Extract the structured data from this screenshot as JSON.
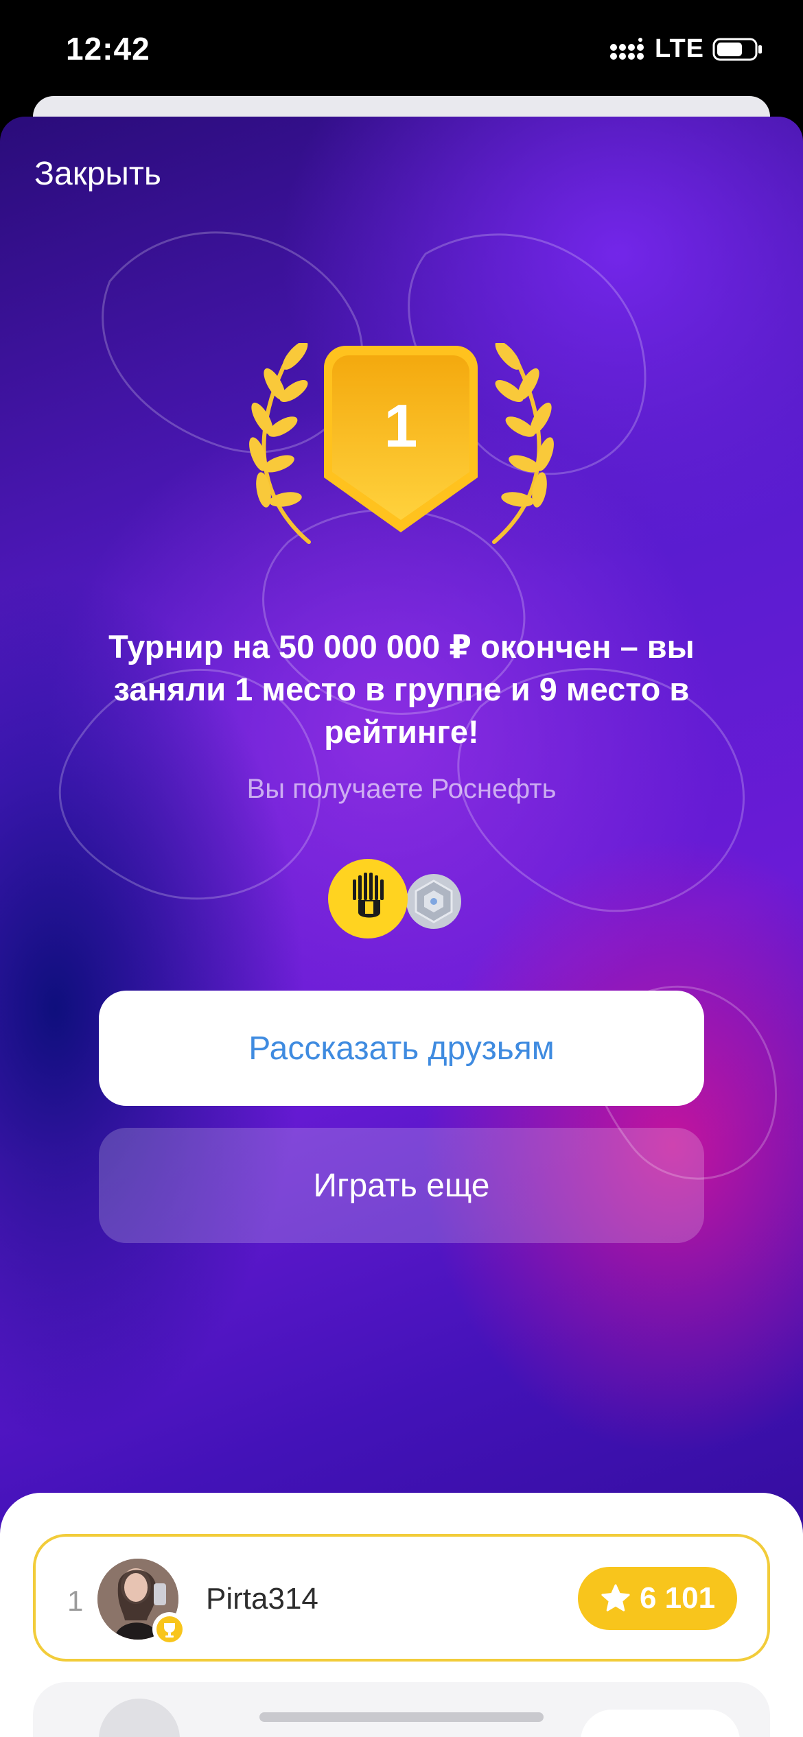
{
  "status_bar": {
    "time": "12:42",
    "network": "LTE",
    "signal_icon": "signal-bars-icon",
    "battery_icon": "battery-icon"
  },
  "modal": {
    "close_label": "Закрыть",
    "place": "1",
    "title": "Турнир на 50 000 000 ₽ окончен – вы заняли 1 место в группе и 9 место в рейтинге!",
    "subtitle": "Вы получаете Роснефть",
    "reward_icons": [
      "rosneft-logo-icon",
      "silver-badge-icon"
    ],
    "share_label": "Рассказать друзьям",
    "play_again_label": "Играть еще"
  },
  "leaderboard": {
    "rows": [
      {
        "rank": "1",
        "username": "Pirta314",
        "score": "6 101",
        "score_icon": "star-icon",
        "badge_icon": "trophy-icon"
      }
    ]
  },
  "colors": {
    "accent_blue": "#3f8be0",
    "gold": "#f8c51c",
    "gold_border": "#f2cc3a"
  }
}
